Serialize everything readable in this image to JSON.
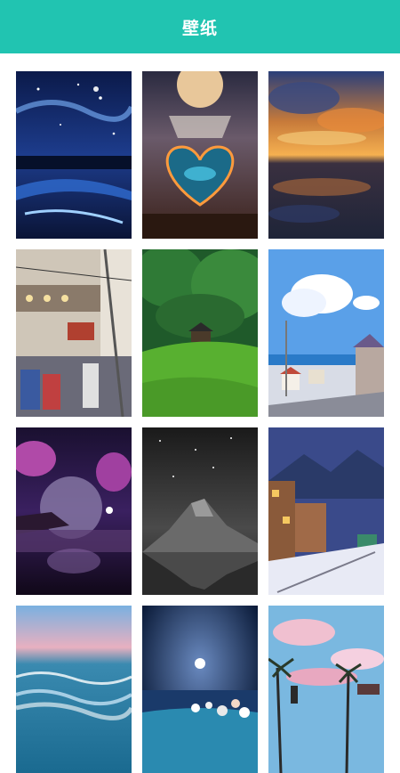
{
  "header": {
    "title": "壁纸"
  },
  "theme": {
    "accent": "#21c4b1",
    "background": "#ffffff"
  },
  "wallpapers": [
    {
      "subject": "galaxy-river-night"
    },
    {
      "subject": "heart-lake-moon"
    },
    {
      "subject": "sunset-reflection"
    },
    {
      "subject": "anime-street"
    },
    {
      "subject": "green-hill-house"
    },
    {
      "subject": "seaside-town-clouds"
    },
    {
      "subject": "purple-moon-tree"
    },
    {
      "subject": "mountain-starry-bw"
    },
    {
      "subject": "snowy-town-train"
    },
    {
      "subject": "ocean-waves"
    },
    {
      "subject": "night-beach-moon"
    },
    {
      "subject": "palm-sunset-street"
    }
  ]
}
